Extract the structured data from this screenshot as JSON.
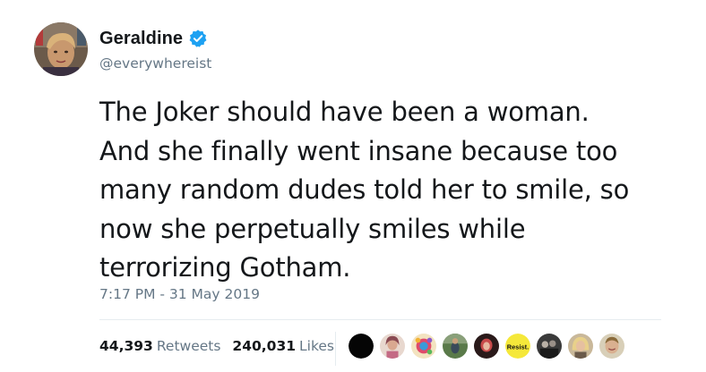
{
  "tweet": {
    "author": {
      "display_name": "Geraldine",
      "handle": "@everywhereist",
      "verified": true,
      "avatar_icon": "profile-photo",
      "verified_icon": "verified-badge-icon"
    },
    "text": "The Joker should have been a woman.\nAnd she finally went insane because too\nmany random dudes told her to smile, so\nnow she perpetually smiles while\nterrorizing Gotham.",
    "timestamp": "7:17 PM - 31 May 2019",
    "stats": {
      "retweets_count": "44,393",
      "retweets_label": "Retweets",
      "likes_count": "240,031",
      "likes_label": "Likes"
    },
    "likers": [
      {
        "avatar": "black-circle"
      },
      {
        "avatar": "woman-portrait"
      },
      {
        "avatar": "colorful-pattern"
      },
      {
        "avatar": "outdoor-photo"
      },
      {
        "avatar": "red-portrait"
      },
      {
        "avatar": "resist-badge",
        "text": "Resist."
      },
      {
        "avatar": "group-photo"
      },
      {
        "avatar": "blonde-portrait"
      },
      {
        "avatar": "smiling-portrait"
      }
    ]
  },
  "colors": {
    "text_primary": "#14171a",
    "text_secondary": "#657786",
    "verified_blue": "#1da1f2",
    "divider": "#e6ecf0"
  }
}
